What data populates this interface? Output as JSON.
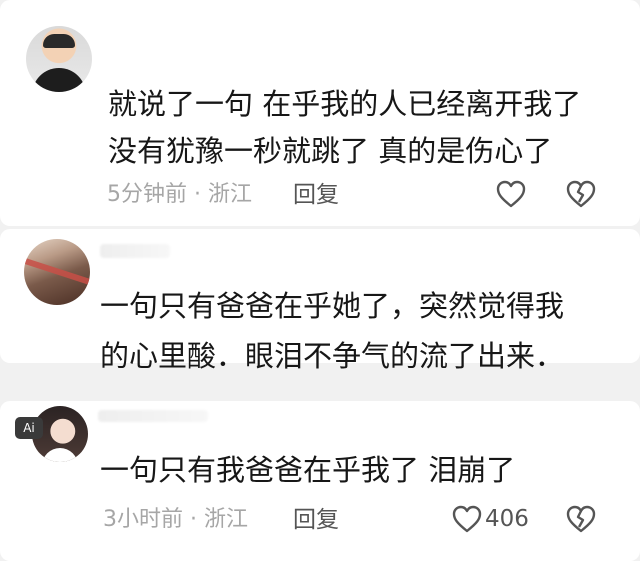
{
  "comments": [
    {
      "lines": [
        "就说了一句 在乎我的人已经离开我了",
        "没有犹豫一秒就跳了 真的是伤心了"
      ],
      "meta": "5分钟前 · 浙江",
      "reply_label": "回复",
      "like_icon": "heart-outline-icon",
      "dislike_icon": "broken-heart-icon"
    },
    {
      "lines": [
        "一句只有爸爸在乎她了，突然觉得我",
        "的心里酸．眼泪不争气的流了出来．"
      ]
    },
    {
      "badge": "Ai",
      "lines": [
        "一句只有我爸爸在乎我了 泪崩了"
      ],
      "meta": "3小时前 · 浙江",
      "reply_label": "回复",
      "like_count": "406",
      "like_icon": "heart-outline-icon",
      "dislike_icon": "broken-heart-icon"
    }
  ],
  "colors": {
    "background": "#f1f1f1",
    "card": "#ffffff",
    "text": "#171717",
    "meta": "#a6a6a6",
    "icon": "#555555"
  }
}
